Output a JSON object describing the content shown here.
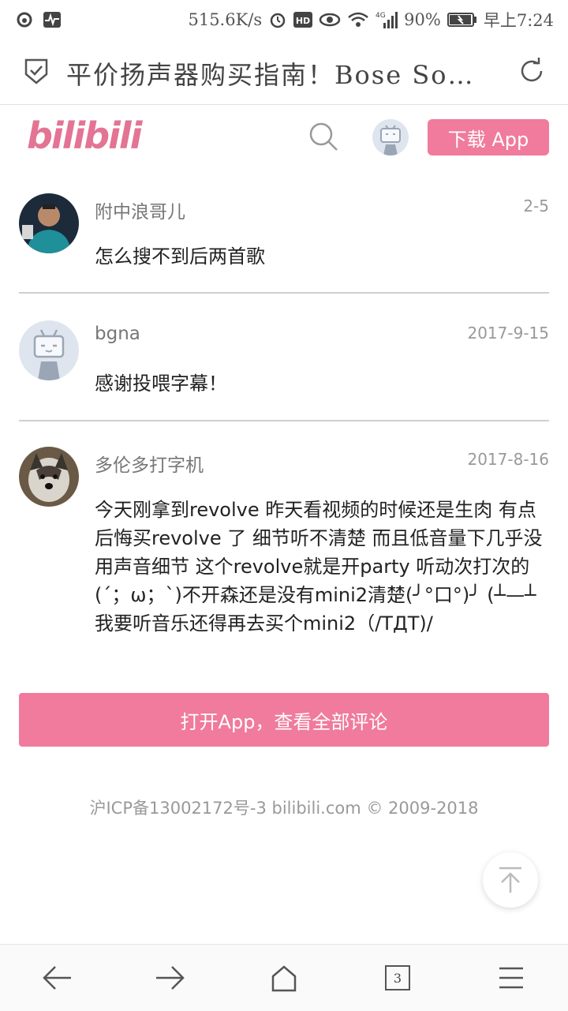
{
  "status_bar": {
    "speed": "515.6K/s",
    "network": "4G",
    "battery": "90%",
    "time": "早上7:24",
    "icons": [
      "weibo-icon",
      "activity-icon",
      "alarm-icon",
      "hd-icon",
      "eye-icon",
      "wifi-icon",
      "signal-icon",
      "battery-icon"
    ]
  },
  "browser": {
    "title": "平价扬声器购买指南！Bose So…",
    "shield_icon": "shield-check-icon",
    "reload_icon": "reload-icon"
  },
  "header": {
    "logo": "bilibili",
    "download_label": "下载 App",
    "brand_color": "#f07b9c"
  },
  "comments": [
    {
      "user": "附中浪哥儿",
      "date": "2-5",
      "text": "怎么搜不到后两首歌"
    },
    {
      "user": "bgna",
      "date": "2017-9-15",
      "text": "感谢投喂字幕！"
    },
    {
      "user": "多伦多打字机",
      "date": "2017-8-16",
      "text": "今天刚拿到revolve 昨天看视频的时候还是生肉 有点后悔买revolve 了 细节听不清楚 而且低音量下几乎没用声音细节 这个revolve就是开party 听动次打次的(´；ω；`)不开森还是没有mini2清楚(╯°口°)╯ (┴—┴ 我要听音乐还得再去买个mini2（/TДT)/"
    }
  ],
  "open_app_label": "打开App，查看全部评论",
  "footer": "沪ICP备13002172号-3 bilibili.com © 2009-2018",
  "bottom_nav": {
    "tab_count": "3"
  }
}
